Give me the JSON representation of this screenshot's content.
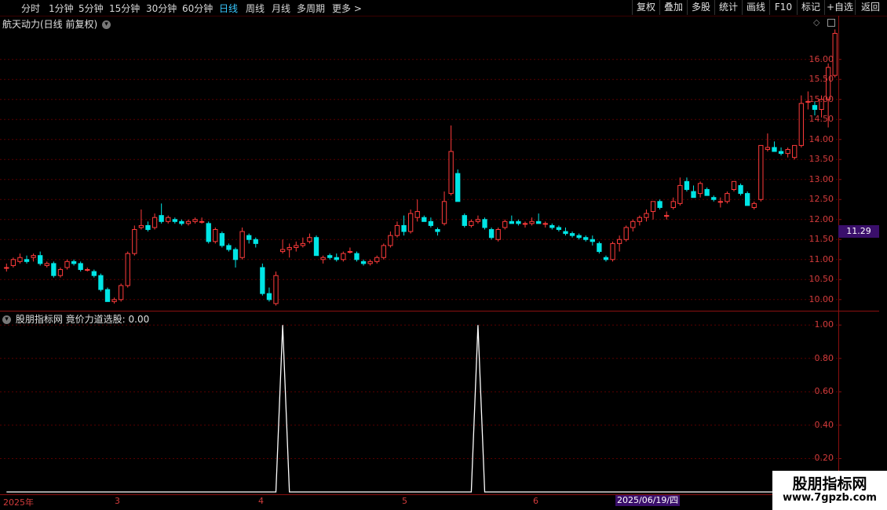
{
  "toolbar": {
    "timeframes": [
      "分时",
      "1分钟",
      "5分钟",
      "15分钟",
      "30分钟",
      "60分钟",
      "日线",
      "周线",
      "月线",
      "多周期",
      "更多 >"
    ],
    "active": "日线",
    "right_buttons": [
      "复权",
      "叠加",
      "多股",
      "统计",
      "画线",
      "F10",
      "标记",
      "+自选",
      "返回"
    ]
  },
  "main": {
    "title": "航天动力(日线 前复权)",
    "current_price_label": "11.29",
    "yticks": [
      "16.00",
      "15.50",
      "15.00",
      "14.50",
      "14.00",
      "13.50",
      "13.00",
      "12.50",
      "12.00",
      "11.50",
      "11.00",
      "10.50",
      "10.00"
    ]
  },
  "sub": {
    "title": "股朋指标网 竟价力道选股: 0.00",
    "yticks": [
      "1.00",
      "0.80",
      "0.60",
      "0.40",
      "0.20"
    ]
  },
  "date_axis": {
    "labels": [
      "2025年",
      "3",
      "4",
      "5",
      "6"
    ],
    "selected_date": "2025/06/19/四"
  },
  "watermark": {
    "line1": "股朋指标网",
    "line2": "www.7gpzb.com"
  },
  "colors": {
    "up": "#ff3b3b",
    "down": "#00e5e5",
    "grid": "#5a0000",
    "indicator": "#ffffff"
  },
  "chart_data": [
    {
      "type": "candlestick",
      "title": "航天动力(日线 前复权)",
      "ylim": [
        9.8,
        16.7
      ],
      "candles": [
        [
          10.8,
          10.9,
          10.7,
          10.8
        ],
        [
          10.85,
          11.05,
          10.8,
          11.0
        ],
        [
          10.95,
          11.15,
          10.9,
          11.05
        ],
        [
          11.0,
          11.1,
          10.9,
          10.95
        ],
        [
          11.05,
          11.15,
          10.95,
          11.1
        ],
        [
          11.1,
          11.2,
          10.85,
          10.9
        ],
        [
          10.85,
          10.95,
          10.8,
          10.9
        ],
        [
          10.9,
          10.95,
          10.55,
          10.6
        ],
        [
          10.6,
          10.8,
          10.55,
          10.75
        ],
        [
          10.8,
          11.0,
          10.75,
          10.95
        ],
        [
          10.95,
          11.0,
          10.85,
          10.9
        ],
        [
          10.9,
          10.95,
          10.7,
          10.75
        ],
        [
          10.75,
          10.8,
          10.7,
          10.75
        ],
        [
          10.7,
          10.75,
          10.55,
          10.6
        ],
        [
          10.6,
          10.65,
          10.2,
          10.25
        ],
        [
          10.25,
          10.3,
          9.95,
          9.95
        ],
        [
          9.95,
          10.05,
          9.9,
          10.0
        ],
        [
          10.0,
          10.4,
          9.95,
          10.35
        ],
        [
          10.35,
          11.2,
          10.3,
          11.15
        ],
        [
          11.15,
          11.85,
          11.1,
          11.75
        ],
        [
          11.8,
          12.25,
          11.75,
          11.85
        ],
        [
          11.85,
          11.95,
          11.7,
          11.75
        ],
        [
          11.8,
          12.15,
          11.75,
          12.05
        ],
        [
          12.1,
          12.4,
          11.9,
          11.95
        ],
        [
          11.95,
          12.1,
          11.9,
          12.05
        ],
        [
          12.0,
          12.05,
          11.9,
          11.95
        ],
        [
          11.95,
          12.0,
          11.85,
          11.9
        ],
        [
          11.9,
          12.0,
          11.85,
          11.95
        ],
        [
          11.95,
          12.05,
          11.9,
          12.0
        ],
        [
          11.95,
          12.05,
          11.9,
          11.95
        ],
        [
          11.9,
          11.95,
          11.4,
          11.45
        ],
        [
          11.45,
          11.8,
          11.4,
          11.75
        ],
        [
          11.65,
          11.7,
          11.3,
          11.35
        ],
        [
          11.35,
          11.4,
          11.2,
          11.25
        ],
        [
          11.25,
          11.3,
          10.8,
          11.0
        ],
        [
          11.05,
          11.8,
          11.0,
          11.7
        ],
        [
          11.6,
          11.65,
          11.4,
          11.5
        ],
        [
          11.5,
          11.55,
          11.3,
          11.4
        ],
        [
          10.8,
          10.9,
          10.1,
          10.15
        ],
        [
          10.15,
          10.3,
          9.95,
          10.0
        ],
        [
          9.9,
          10.7,
          9.85,
          10.6
        ],
        [
          11.2,
          11.5,
          11.15,
          11.25
        ],
        [
          11.25,
          11.4,
          11.05,
          11.3
        ],
        [
          11.3,
          11.45,
          11.2,
          11.35
        ],
        [
          11.35,
          11.55,
          11.3,
          11.4
        ],
        [
          11.45,
          11.65,
          11.4,
          11.55
        ],
        [
          11.55,
          11.6,
          11.1,
          11.1
        ],
        [
          11.0,
          11.1,
          10.9,
          11.05
        ],
        [
          11.1,
          11.15,
          11.0,
          11.05
        ],
        [
          11.05,
          11.15,
          10.95,
          11.0
        ],
        [
          11.0,
          11.2,
          10.95,
          11.15
        ],
        [
          11.2,
          11.3,
          11.15,
          11.2
        ],
        [
          11.15,
          11.2,
          10.95,
          11.0
        ],
        [
          10.95,
          11.0,
          10.85,
          10.9
        ],
        [
          10.9,
          11.0,
          10.85,
          10.95
        ],
        [
          10.95,
          11.1,
          10.9,
          11.05
        ],
        [
          11.05,
          11.4,
          11.0,
          11.35
        ],
        [
          11.35,
          11.7,
          11.3,
          11.6
        ],
        [
          11.6,
          11.95,
          11.55,
          11.85
        ],
        [
          11.85,
          12.1,
          11.6,
          11.7
        ],
        [
          11.7,
          12.25,
          11.65,
          12.15
        ],
        [
          12.05,
          12.5,
          11.95,
          12.2
        ],
        [
          12.05,
          12.1,
          11.95,
          11.95
        ],
        [
          11.95,
          12.05,
          11.8,
          11.85
        ],
        [
          11.75,
          11.8,
          11.6,
          11.7
        ],
        [
          11.9,
          12.7,
          11.85,
          12.45
        ],
        [
          12.65,
          14.35,
          12.6,
          13.7
        ],
        [
          13.15,
          13.25,
          12.45,
          12.45
        ],
        [
          12.1,
          12.15,
          11.8,
          11.85
        ],
        [
          11.85,
          12.0,
          11.8,
          11.95
        ],
        [
          11.95,
          12.1,
          11.9,
          12.0
        ],
        [
          12.0,
          12.05,
          11.75,
          11.8
        ],
        [
          11.75,
          11.8,
          11.5,
          11.55
        ],
        [
          11.5,
          11.8,
          11.45,
          11.75
        ],
        [
          11.8,
          12.0,
          11.75,
          11.95
        ],
        [
          11.95,
          12.1,
          11.9,
          11.9
        ],
        [
          11.95,
          12.0,
          11.85,
          11.9
        ],
        [
          11.9,
          11.95,
          11.8,
          11.9
        ],
        [
          11.9,
          12.05,
          11.85,
          11.95
        ],
        [
          11.95,
          12.15,
          11.9,
          11.9
        ],
        [
          11.9,
          11.95,
          11.8,
          11.9
        ],
        [
          11.85,
          11.9,
          11.75,
          11.8
        ],
        [
          11.8,
          11.85,
          11.7,
          11.75
        ],
        [
          11.7,
          11.8,
          11.6,
          11.65
        ],
        [
          11.65,
          11.7,
          11.55,
          11.6
        ],
        [
          11.6,
          11.65,
          11.5,
          11.55
        ],
        [
          11.55,
          11.6,
          11.45,
          11.5
        ],
        [
          11.5,
          11.6,
          11.35,
          11.45
        ],
        [
          11.4,
          11.45,
          11.15,
          11.2
        ],
        [
          11.05,
          11.1,
          10.95,
          11.0
        ],
        [
          11.0,
          11.45,
          10.95,
          11.4
        ],
        [
          11.4,
          11.6,
          11.2,
          11.5
        ],
        [
          11.5,
          11.85,
          11.45,
          11.8
        ],
        [
          11.8,
          12.0,
          11.7,
          11.95
        ],
        [
          11.95,
          12.1,
          11.85,
          12.05
        ],
        [
          12.05,
          12.25,
          11.95,
          12.15
        ],
        [
          12.2,
          12.4,
          12.0,
          12.45
        ],
        [
          12.45,
          12.5,
          12.25,
          12.3
        ],
        [
          12.1,
          12.2,
          12.0,
          12.1
        ],
        [
          12.3,
          12.55,
          12.25,
          12.45
        ],
        [
          12.4,
          13.05,
          12.35,
          12.85
        ],
        [
          12.95,
          13.05,
          12.7,
          12.75
        ],
        [
          12.7,
          12.85,
          12.55,
          12.55
        ],
        [
          12.65,
          12.95,
          12.55,
          12.9
        ],
        [
          12.75,
          12.8,
          12.6,
          12.6
        ],
        [
          12.55,
          12.6,
          12.45,
          12.5
        ],
        [
          12.45,
          12.55,
          12.3,
          12.45
        ],
        [
          12.45,
          12.7,
          12.4,
          12.65
        ],
        [
          12.75,
          12.95,
          12.7,
          12.95
        ],
        [
          12.85,
          12.9,
          12.6,
          12.65
        ],
        [
          12.65,
          12.7,
          12.35,
          12.35
        ],
        [
          12.3,
          12.45,
          12.25,
          12.4
        ],
        [
          12.5,
          13.85,
          12.45,
          13.85
        ],
        [
          13.75,
          14.15,
          13.7,
          13.8
        ],
        [
          13.8,
          13.95,
          13.7,
          13.7
        ],
        [
          13.7,
          13.8,
          13.6,
          13.65
        ],
        [
          13.65,
          13.8,
          13.55,
          13.75
        ],
        [
          13.55,
          13.85,
          13.5,
          13.85
        ],
        [
          13.85,
          15.1,
          13.8,
          14.9
        ],
        [
          14.95,
          15.2,
          14.75,
          14.95
        ],
        [
          14.85,
          14.95,
          14.6,
          14.75
        ],
        [
          14.75,
          15.1,
          14.55,
          15.0
        ],
        [
          15.0,
          15.9,
          14.3,
          15.8
        ],
        [
          15.6,
          16.75,
          15.55,
          16.65
        ]
      ]
    },
    {
      "type": "line",
      "title": "股朋指标网 竟价力道选股",
      "ylim": [
        0,
        1.02
      ],
      "series": [
        {
          "values": [
            0,
            0,
            0,
            0,
            0,
            0,
            0,
            0,
            0,
            0,
            0,
            0,
            0,
            0,
            0,
            0,
            0,
            0,
            0,
            0,
            0,
            0,
            0,
            0,
            0,
            0,
            0,
            0,
            0,
            0,
            0,
            0,
            0,
            0,
            0,
            0,
            0,
            0,
            0,
            0,
            0,
            1,
            0,
            0,
            0,
            0,
            0,
            0,
            0,
            0,
            0,
            0,
            0,
            0,
            0,
            0,
            0,
            0,
            0,
            0,
            0,
            0,
            0,
            0,
            0,
            0,
            0,
            0,
            0,
            0,
            1,
            0,
            0,
            0,
            0,
            0,
            0,
            0,
            0,
            0,
            0,
            0,
            0,
            0,
            0,
            0,
            0,
            0,
            0,
            0,
            0,
            0,
            0,
            0,
            0,
            0,
            0,
            0,
            0,
            0,
            0,
            0,
            0,
            0,
            0,
            0,
            0,
            0,
            0,
            0,
            0,
            0,
            0,
            0,
            0,
            0,
            0,
            0,
            0,
            0,
            0,
            0,
            0,
            0,
            0,
            0,
            0,
            0,
            0,
            0,
            0,
            0,
            0,
            0,
            0,
            0,
            0,
            0,
            0,
            0,
            0,
            0,
            0
          ]
        }
      ]
    }
  ]
}
